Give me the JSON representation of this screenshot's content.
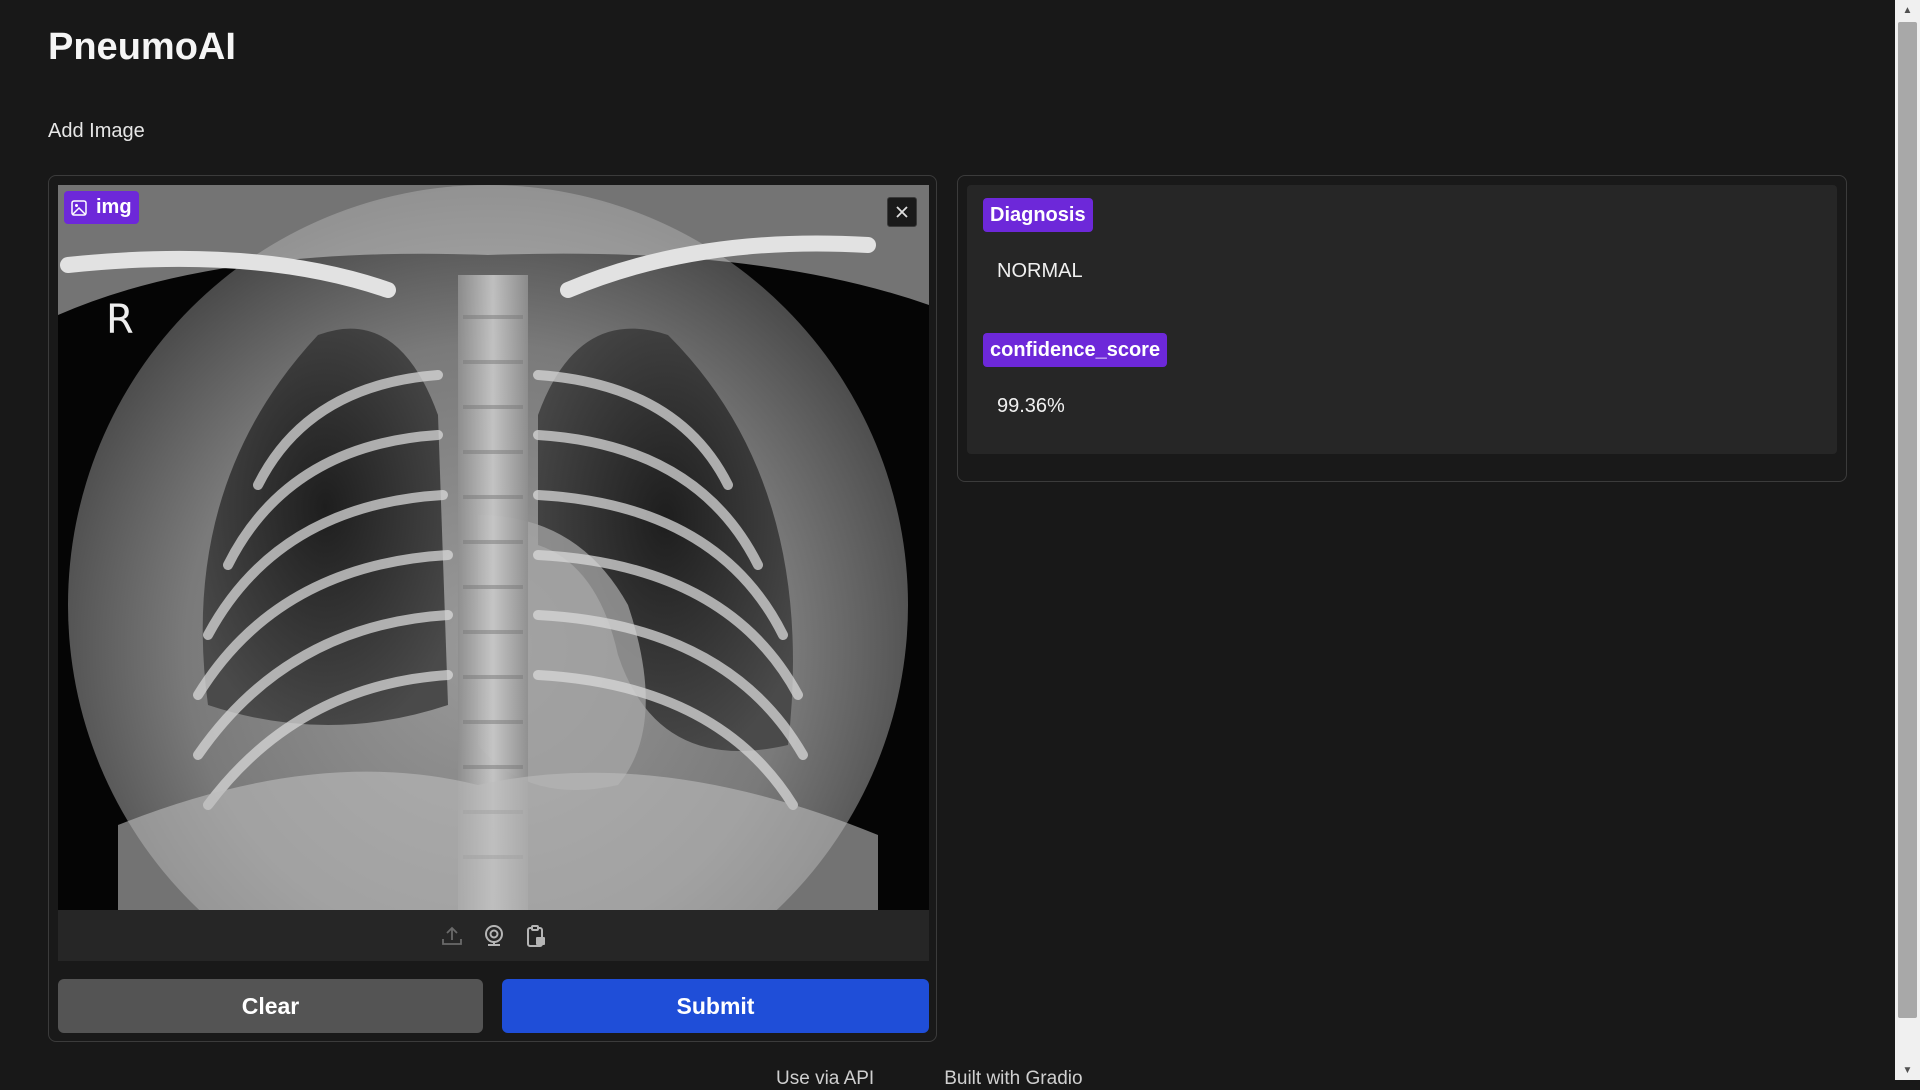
{
  "app": {
    "title": "PneumoAI"
  },
  "input": {
    "section_label": "Add Image",
    "image_label": "img",
    "image_marker": "R",
    "toolbar_icons": [
      "upload-icon",
      "webcam-icon",
      "clipboard-icon"
    ],
    "close_icon": "close-icon"
  },
  "buttons": {
    "clear": "Clear",
    "submit": "Submit"
  },
  "output": {
    "diagnosis": {
      "label": "Diagnosis",
      "value": "NORMAL"
    },
    "confidence": {
      "label": "confidence_score",
      "value": "99.36%"
    }
  },
  "footer": {
    "api_link": "Use via API",
    "built_with": "Built with Gradio"
  },
  "colors": {
    "accent_label": "#6d28d9",
    "primary_button": "#1f4ed8",
    "secondary_button": "#545454",
    "background": "#181818",
    "panel": "#262626"
  }
}
